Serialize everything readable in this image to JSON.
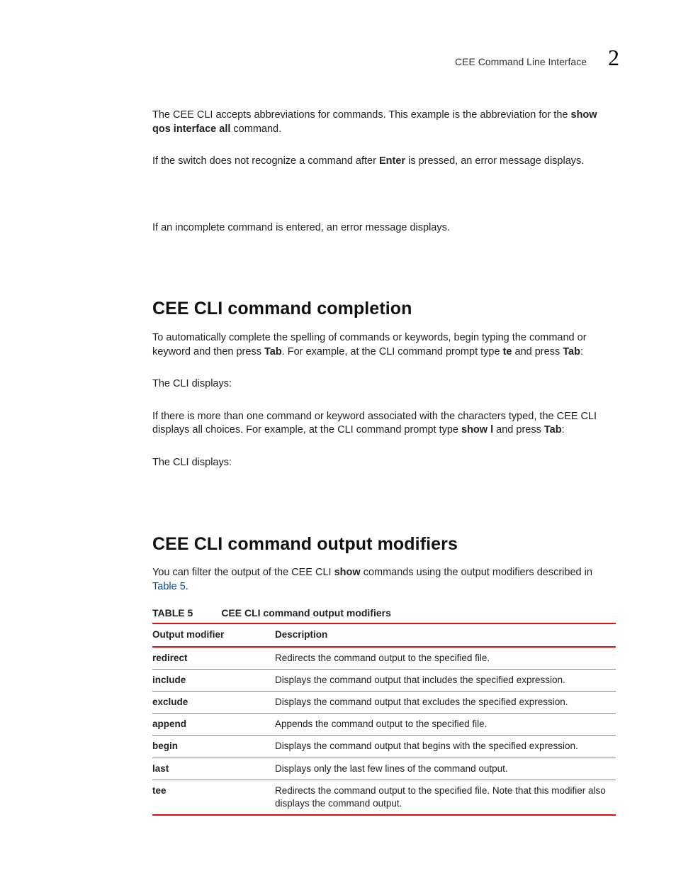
{
  "header": {
    "title": "CEE Command Line Interface",
    "chapter": "2"
  },
  "content": {
    "p1a": "The CEE CLI accepts abbreviations for commands. This example is the abbreviation for the ",
    "p1b": "show qos interface all",
    "p1c": " command.",
    "p2a": "If the switch does not recognize a command after ",
    "p2b": "Enter",
    "p2c": " is pressed, an error message displays.",
    "p3": "If an incomplete command is entered, an error message displays.",
    "h1": "CEE CLI command completion",
    "p4a": "To automatically complete the spelling of commands or keywords, begin typing the command or keyword and then press ",
    "p4b": "Tab",
    "p4c": ". For example, at the CLI command prompt type ",
    "p4d": "te",
    "p4e": " and press ",
    "p4f": "Tab",
    "p4g": ":",
    "p5": "The CLI displays:",
    "p6a": "If there is more than one command or keyword associated with the characters typed, the CEE CLI displays all choices. For example, at the CLI command prompt type ",
    "p6b": "show l",
    "p6c": " and press ",
    "p6d": "Tab",
    "p6e": ":",
    "p7": "The CLI displays:",
    "h2": "CEE CLI command output modifiers",
    "p8a": "You can filter the output of the CEE CLI ",
    "p8b": "show",
    "p8c": " commands using the output modifiers described in ",
    "p8link": "Table 5",
    "p8d": ".",
    "table": {
      "label": "TABLE 5",
      "title": "CEE CLI command output modifiers",
      "col1": "Output modifier",
      "col2": "Description",
      "rows": [
        {
          "m": "redirect",
          "d": "Redirects the command output to the specified file."
        },
        {
          "m": "include",
          "d": "Displays the command output that includes the specified expression."
        },
        {
          "m": "exclude",
          "d": "Displays the command output that excludes the specified expression."
        },
        {
          "m": "append",
          "d": "Appends the command output to the specified file."
        },
        {
          "m": "begin",
          "d": "Displays the command output that begins with the specified expression."
        },
        {
          "m": "last",
          "d": "Displays only the last few lines of the command output."
        },
        {
          "m": "tee",
          "d": "Redirects the command output to the specified file. Note that this modifier also displays the command output."
        }
      ]
    }
  }
}
